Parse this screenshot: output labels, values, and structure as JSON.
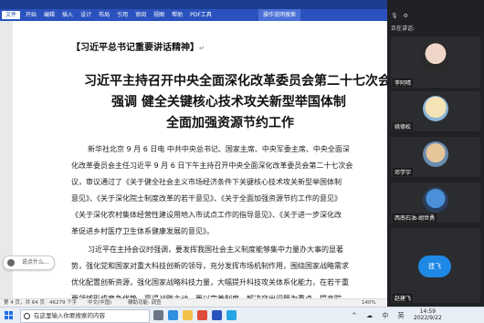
{
  "titlebar": {
    "doc_title": "",
    "recording_badge": "",
    "account": "",
    "window_controls": "— ▢ ✕"
  },
  "ribbon": {
    "tabs": [
      "文件",
      "开始",
      "编辑",
      "插入",
      "设计",
      "布局",
      "引用",
      "审阅",
      "视图",
      "帮助",
      "PDF工具"
    ],
    "task_pane": "操作说明搜索"
  },
  "doc": {
    "header": "【习近平总书记重要讲话精神】",
    "title_lines": [
      "习近平主持召开中央全面深化改革委员会第二十七次会议",
      "强调  健全关键核心技术攻关新型举国体制",
      "全面加强资源节约工作"
    ],
    "paragraphs": [
      "新华社北京 9 月 6 日电  中共中央总书记、国家主席、中央军委主席、中央全面深",
      "化改革委员会主任习近平 9 月 6 日下午主持召开中央全面深化改革委员会第二十七次会",
      "议，审议通过了《关于健全社会主义市场经济条件下关键核心技术攻关新型举国体制",
      "意见》、《关于深化院士制度改革的若干意见》、《关于全面加强资源节约工作的意见》",
      "《关于深化农村集体经营性建设用地入市试点工作的指导意见》、《关于进一步深化改",
      "革促进乡村医疗卫生体系健康发展的意见》。",
      "习近平在主持会议时强调，要发挥我国社会主义制度能够集中力量办大事的显著",
      "势，强化党和国家对重大科技创新的领导，充分发挥市场机制作用，围绕国家战略需求",
      "优化配置创新资源，强化国家战略科技力量，大幅提升科技攻关体系化能力，在若干重",
      "要领域形成竞争优势、赢得战略主动。要以完善制度、解决突出问题为重点，提高院"
    ]
  },
  "side_widget": {
    "label": "说点什么..."
  },
  "status_bar": {
    "page": "第 4 页，共 64 页",
    "words": "46279 个字",
    "language": "中文(中国)",
    "accessibility": "辅助功能: 调查",
    "zoom": "140%"
  },
  "meeting": {
    "header": "",
    "tabs": "正在讲话:",
    "participants": [
      {
        "name": "李阿晴"
      },
      {
        "name": "姚德松"
      },
      {
        "name": "邓学宇"
      },
      {
        "name": "西南石油-胡世勇"
      },
      {
        "name": "赵建飞"
      }
    ],
    "speaker_button": "建飞"
  },
  "taskbar": {
    "search_placeholder": "在这里输入你要搜索的内容",
    "time": "14:59",
    "date": "2022/9/22",
    "tray": "^ ☁ 中 英"
  },
  "colors": {
    "ribbon_blue": "#2a52be",
    "titlebar_blue": "#1d3d8f",
    "meeting_bg": "#202124",
    "accent": "#1e88e5"
  }
}
